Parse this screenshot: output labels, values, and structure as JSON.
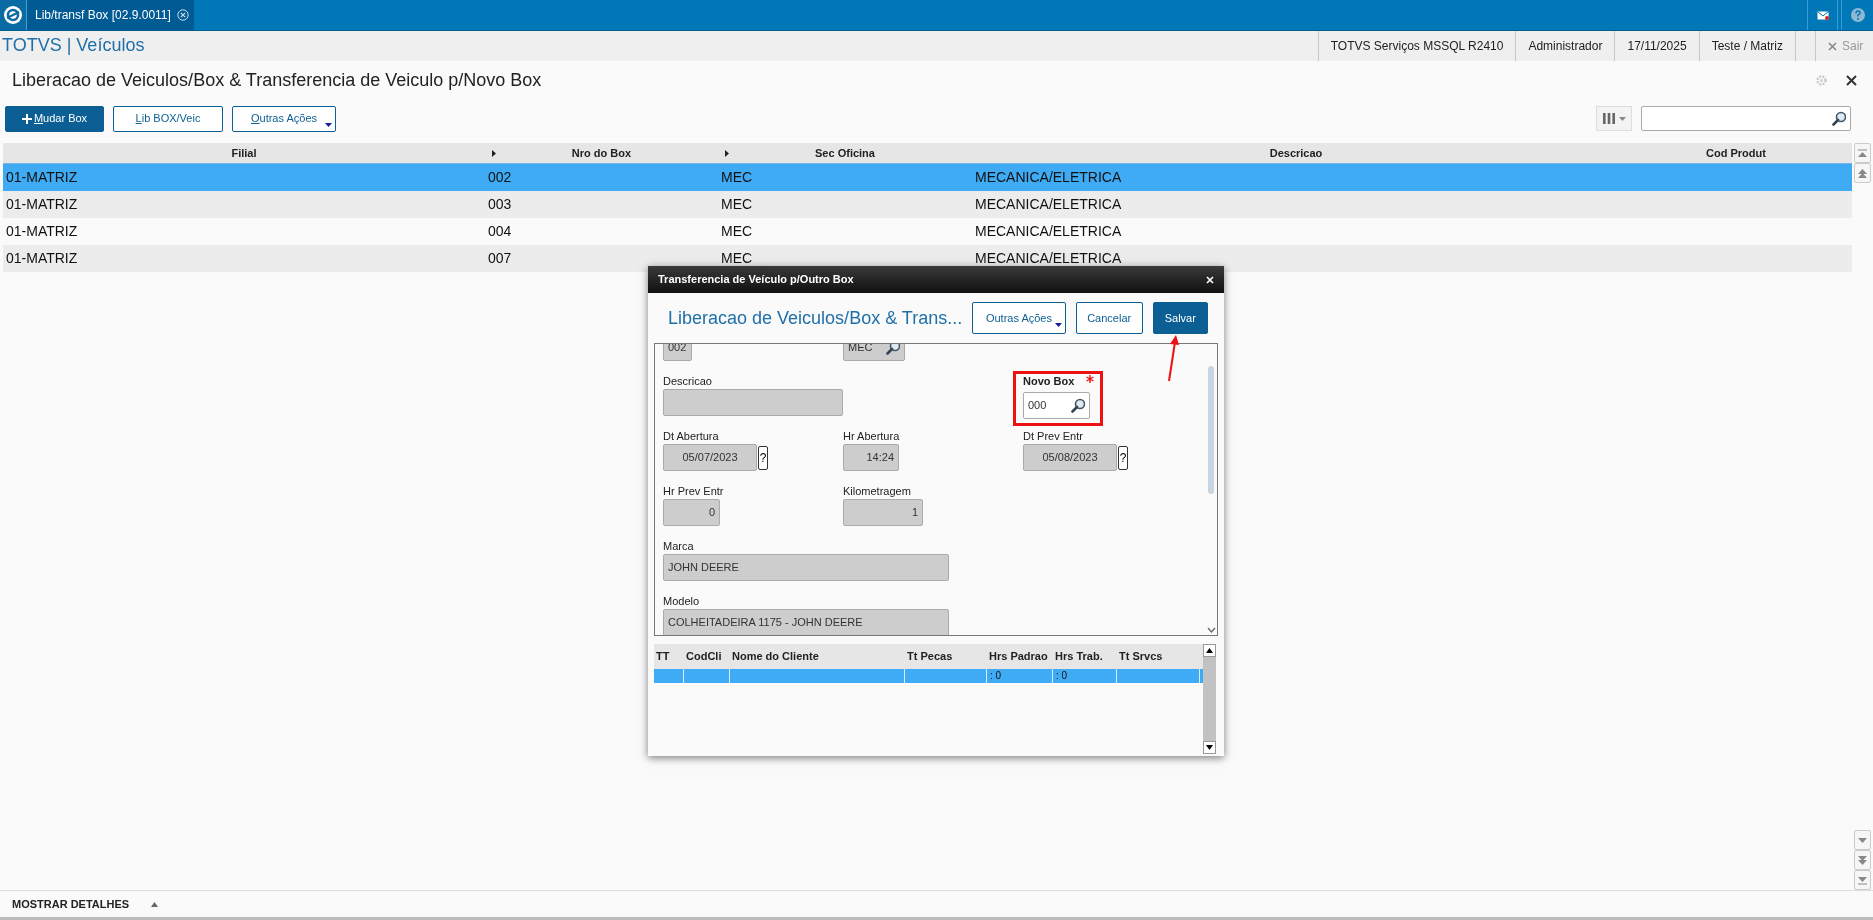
{
  "app_tab": {
    "label": "Lib/transf Box [02.9.0011]",
    "selected": true
  },
  "header": {
    "title": "TOTVS | Veículos",
    "info": [
      "TOTVS Serviços MSSQL R2410",
      "Administrador",
      "17/11/2025",
      "Teste / Matriz"
    ],
    "exit": "Sair"
  },
  "page": {
    "title": "Liberacao de Veiculos/Box & Transferencia de Veiculo p/Novo Box"
  },
  "toolbar": {
    "buttons": [
      {
        "label": "Mudar Box",
        "kind": "primary",
        "dropdown": false
      },
      {
        "label": "Lib BOX/Veic",
        "kind": "secondary",
        "dropdown": false
      },
      {
        "label": "Outras Ações",
        "kind": "secondary",
        "dropdown": true
      }
    ]
  },
  "table": {
    "columns": [
      {
        "label": "Filial",
        "marker": false
      },
      {
        "label": "Nro do Box",
        "marker": true
      },
      {
        "label": "Sec Oficina",
        "marker": true
      },
      {
        "label": "Descricao",
        "marker": false
      },
      {
        "label": "Cod Produt",
        "marker": false
      }
    ],
    "rows": [
      {
        "cells": [
          "01-MATRIZ",
          "002",
          "MEC",
          "MECANICA/ELETRICA"
        ],
        "selected": true
      },
      {
        "cells": [
          "01-MATRIZ",
          "003",
          "MEC",
          "MECANICA/ELETRICA"
        ],
        "selected": false
      },
      {
        "cells": [
          "01-MATRIZ",
          "004",
          "MEC",
          "MECANICA/ELETRICA"
        ],
        "selected": false
      },
      {
        "cells": [
          "01-MATRIZ",
          "007",
          "MEC",
          "MECANICA/ELETRICA"
        ],
        "selected": false
      }
    ]
  },
  "dialog": {
    "title": "Transferencia de Veículo p/Outro Box",
    "heading": "Liberacao de Veiculos/Box & Trans...",
    "buttons": [
      {
        "label": "Outras Ações",
        "kind": "secondary",
        "dropdown": true,
        "pointed": false
      },
      {
        "label": "Cancelar",
        "kind": "secondary",
        "dropdown": false,
        "pointed": false
      },
      {
        "label": "Salvar",
        "kind": "primary",
        "dropdown": false,
        "pointed": true
      }
    ],
    "form_rows": [
      [
        {
          "value": "002",
          "kind": "text"
        },
        {
          "value": "MEC",
          "kind": "lookup"
        }
      ],
      [
        {
          "label": "Descricao",
          "kind": "text"
        },
        {
          "label": "Novo Box",
          "value": "000",
          "kind": "lookup",
          "required": true,
          "highlighted": true,
          "editable": true
        }
      ],
      [
        {
          "label": "Dt Abertura",
          "value": "05/07/2023",
          "kind": "date",
          "help": "?"
        },
        {
          "label": "Hr Abertura",
          "value": "14:24",
          "kind": "number"
        },
        {
          "label": "Dt Prev Entr",
          "value": "05/08/2023",
          "kind": "date",
          "help": "?"
        }
      ],
      [
        {
          "label": "Hr Prev Entr",
          "value": "0",
          "kind": "number"
        },
        {
          "label": "Kilometragem",
          "value": "1",
          "kind": "number"
        }
      ],
      [
        {
          "label": "Marca",
          "value": "JOHN DEERE",
          "kind": "text"
        }
      ],
      [
        {
          "label": "Modelo",
          "value": "COLHEITADEIRA 1175 - JOHN DEERE",
          "kind": "text"
        }
      ]
    ],
    "grid": {
      "columns": [
        "TT",
        "CodCli",
        "Nome do Cliente",
        "Tt Pecas",
        "Hrs Padrao",
        "Hrs Trab.",
        "Tt Srvcs"
      ],
      "rows": [
        {
          "cells": [
            "",
            "",
            "",
            "",
            ": 0",
            ": 0",
            ""
          ],
          "selected": true
        }
      ]
    }
  },
  "footer": {
    "label": "MOSTRAR DETALHES"
  }
}
